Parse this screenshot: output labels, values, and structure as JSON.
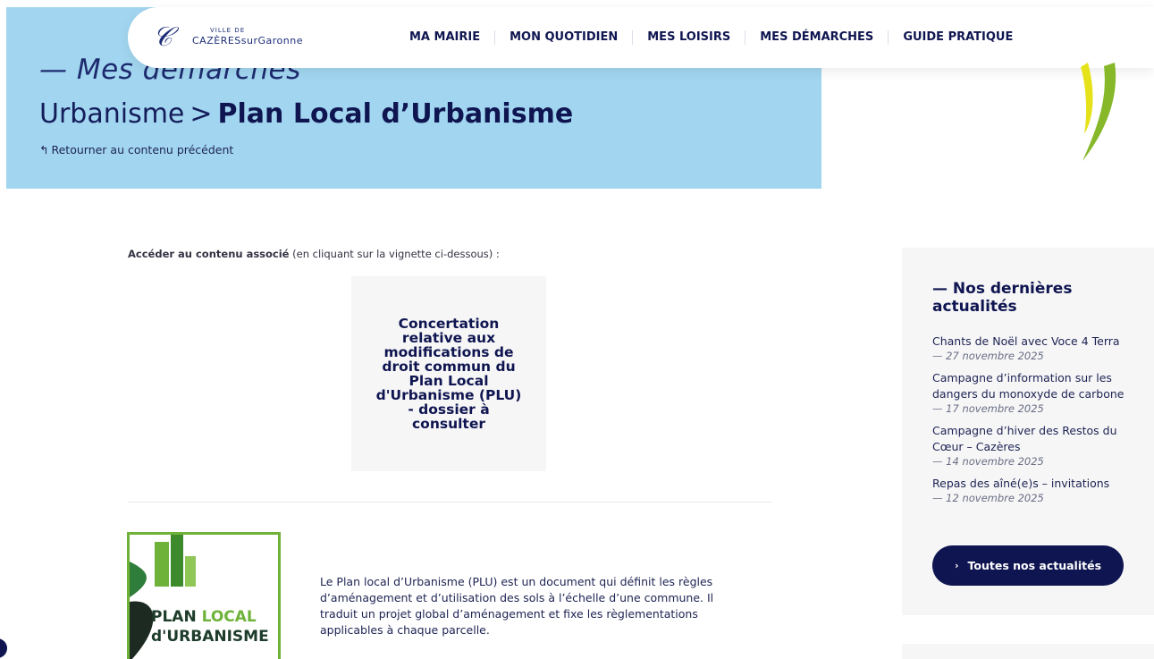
{
  "header": {
    "logo": {
      "ville": "VILLE DE",
      "name": "CAZÈRES",
      "sur": "surGaronne"
    },
    "nav": [
      "MA MAIRIE",
      "MON QUOTIDIEN",
      "MES LOISIRS",
      "MES DÉMARCHES",
      "GUIDE PRATIQUE"
    ]
  },
  "hero": {
    "kicker": "— Mes démarches",
    "parent": "Urbanisme",
    "separator": ">",
    "current": "Plan Local d’Urbanisme",
    "back_arrow": "↰",
    "back_label": "Retourner au contenu précédent"
  },
  "main": {
    "assoc_bold": "Accéder au contenu associé",
    "assoc_rest": "(en cliquant sur la vignette ci-dessous) :",
    "card_text": "Concertation relative aux modifications de droit commun du Plan Local d'Urbanisme (PLU) - dossier à consulter",
    "plu_image": {
      "line1a": "PLAN",
      "line1b": "LOCAL",
      "line2": "d'URBANISME"
    },
    "description": "Le Plan local d’Urbanisme (PLU) est un document qui définit les règles d’aménagement et d’utilisation des sols à l’échelle d’une commune. Il traduit un projet global d’aménagement et fixe les règlementations applicables à chaque parcelle."
  },
  "sidebar": {
    "title": "— Nos dernières actualités",
    "news": [
      {
        "title": "Chants de Noël avec Voce 4 Terra",
        "date": "— 27 novembre 2025"
      },
      {
        "title": "Campagne d’information sur les dangers du monoxyde de carbone",
        "date": "— 17 novembre 2025"
      },
      {
        "title": "Campagne d’hiver des Restos du Cœur – Cazères",
        "date": "— 14 novembre 2025"
      },
      {
        "title": "Repas des aîné(e)s – invitations",
        "date": "— 12 novembre 2025"
      }
    ],
    "button_chevron": "›",
    "button_label": "Toutes nos actualités"
  },
  "colors": {
    "hero_bg": "#a2d6f0",
    "navy": "#0f1550",
    "green": "#6fb23a",
    "panel": "#f6f6f7"
  }
}
